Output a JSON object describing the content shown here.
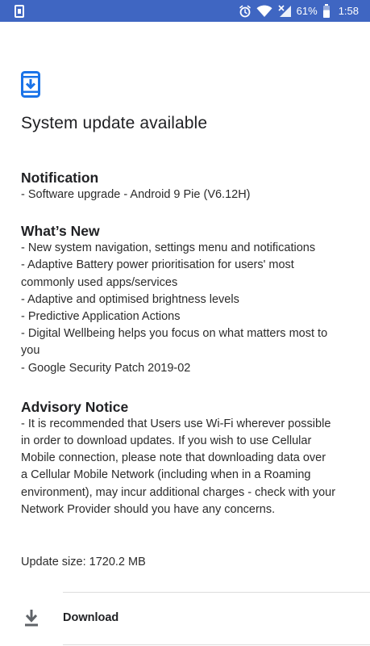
{
  "status_bar": {
    "battery_percent": "61%",
    "time": "1:58",
    "icons": [
      "phone-notification-icon",
      "alarm-icon",
      "wifi-icon",
      "cell-signal-icon",
      "battery-icon"
    ]
  },
  "update": {
    "title": "System update available",
    "notification": {
      "heading": "Notification",
      "lines": [
        "- Software upgrade - Android 9 Pie (V6.12H)"
      ]
    },
    "whats_new": {
      "heading": "What’s New",
      "lines": [
        "- New system navigation, settings menu and notifications",
        "- Adaptive Battery power prioritisation for users' most",
        "commonly used apps/services",
        "- Adaptive and optimised brightness levels",
        "- Predictive Application Actions",
        "- Digital Wellbeing helps you focus on what matters most to",
        "you",
        "- Google Security Patch 2019-02"
      ]
    },
    "advisory": {
      "heading": "Advisory Notice",
      "lines": [
        "- It is recommended that Users use Wi-Fi wherever possible",
        "in order to download updates. If you wish to use Cellular",
        "Mobile connection, please note that downloading data over",
        "a Cellular Mobile Network (including when in a Roaming",
        "environment), may incur additional charges - check with your",
        "Network Provider should you have any concerns."
      ]
    },
    "size_text": "Update size: 1720.2 MB"
  },
  "actions": {
    "download_label": "Download"
  },
  "colors": {
    "status_bar": "#3f66c2",
    "accent_icon": "#1a73e8",
    "text": "#202124"
  }
}
